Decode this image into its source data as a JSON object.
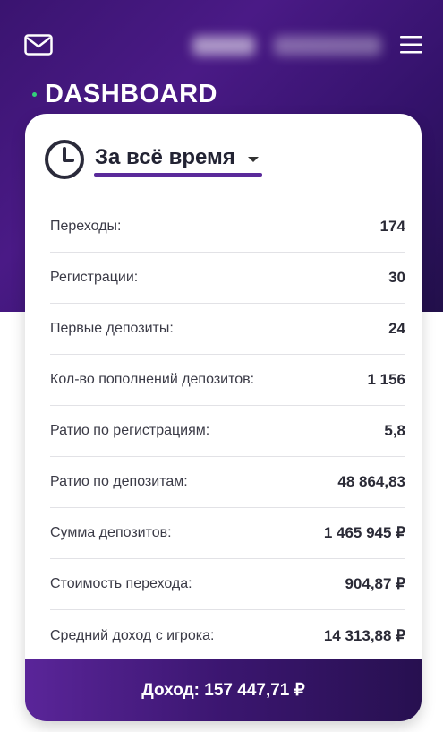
{
  "header": {
    "mail_icon": "mail-icon",
    "menu_icon": "hamburger-menu-icon",
    "title": "DASHBOARD",
    "accent_dot_color": "#33d07a"
  },
  "period": {
    "icon": "clock-icon",
    "label": "За всё время"
  },
  "stats": [
    {
      "label": "Переходы:",
      "value": "174"
    },
    {
      "label": "Регистрации:",
      "value": "30"
    },
    {
      "label": "Первые депозиты:",
      "value": "24"
    },
    {
      "label": "Кол-во пополнений депозитов:",
      "value": "1 156"
    },
    {
      "label": "Ратио по регистрациям:",
      "value": "5,8"
    },
    {
      "label": "Ратио по депозитам:",
      "value": "48 864,83"
    },
    {
      "label": "Сумма депозитов:",
      "value": "1 465 945 ₽"
    },
    {
      "label": "Стоимость перехода:",
      "value": "904,87 ₽"
    },
    {
      "label": "Средний доход с игрока:",
      "value": "14 313,88 ₽"
    }
  ],
  "footer": {
    "income": "Доход: 157 447,71 ₽"
  },
  "colors": {
    "brand_purple": "#4a1a86",
    "underline": "#5a2a9a"
  }
}
